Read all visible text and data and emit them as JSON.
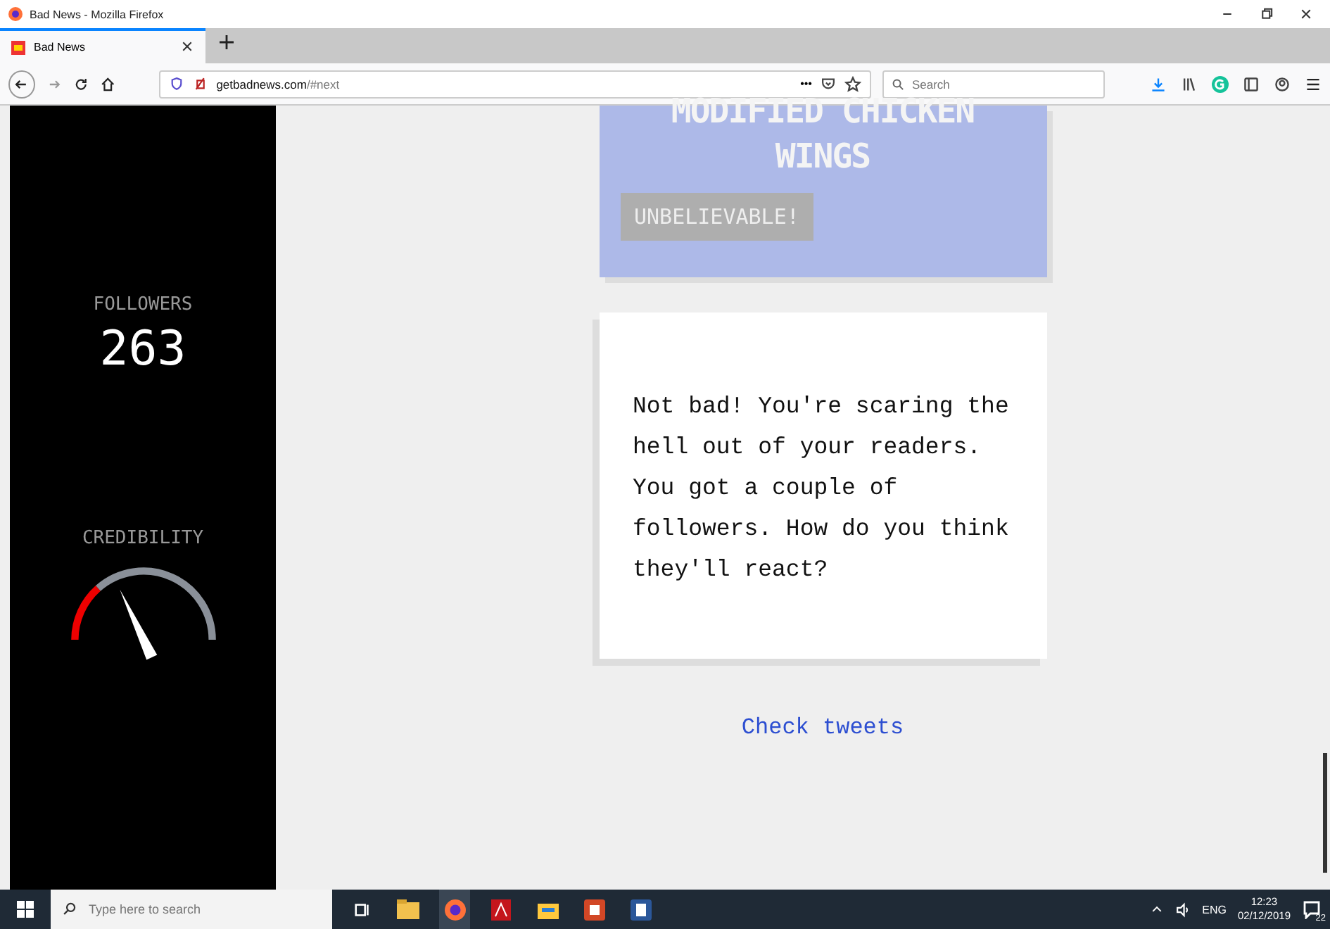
{
  "window": {
    "title": "Bad News - Mozilla Firefox"
  },
  "tabs": [
    {
      "label": "Bad News",
      "selected": true
    }
  ],
  "toolbar": {
    "url_domain": "getbadnews.com",
    "url_path": "/#next",
    "more": "•••",
    "search_placeholder": "Search"
  },
  "sidebar": {
    "followers_label": "FOLLOWERS",
    "followers": "263",
    "credibility_label": "CREDIBILITY",
    "credibility": {
      "level": 0.36
    }
  },
  "headline_card": {
    "headline": "MODIFIED CHICKEN WINGS",
    "button": "UNBELIEVABLE!"
  },
  "message_card": {
    "text": "Not bad! You're scaring the hell out of your readers. You got a couple of followers. How do you think they'll react?"
  },
  "link": "Check tweets",
  "taskbar": {
    "search_placeholder": "Type here to search",
    "language": "ENG",
    "time": "12:23",
    "date": "02/12/2019",
    "notifications": "22"
  }
}
